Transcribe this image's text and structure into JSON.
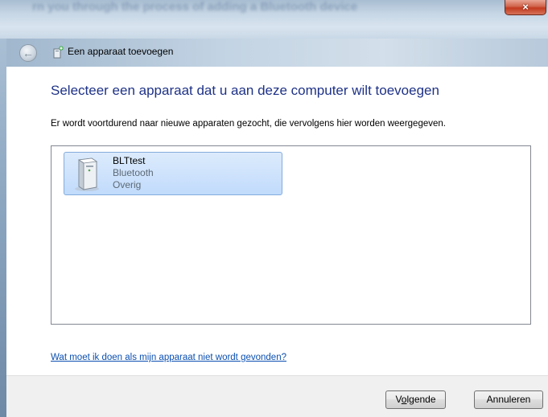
{
  "window": {
    "background_title": "rn you through the process of adding a Bluetooth device",
    "close_glyph": "×"
  },
  "nav": {
    "back_glyph": "←",
    "wizard_title": "Een apparaat toevoegen"
  },
  "main": {
    "heading": "Selecteer een apparaat dat u aan deze computer wilt toevoegen",
    "description": "Er wordt voortdurend naar nieuwe apparaten gezocht, die vervolgens hier worden weergegeven.",
    "devices": [
      {
        "name": "BLTtest",
        "type": "Bluetooth",
        "category": "Overig",
        "icon": "computer-tower-icon",
        "selected": true
      }
    ],
    "help_link": "Wat moet ik doen als mijn apparaat niet wordt gevonden?"
  },
  "footer": {
    "next_label_pre": "V",
    "next_label_mnemonic": "o",
    "next_label_post": "lgende",
    "cancel_label": "Annuleren"
  },
  "colors": {
    "heading": "#1e3287",
    "link": "#0b4fb0",
    "selection": "#c1dbfc"
  }
}
